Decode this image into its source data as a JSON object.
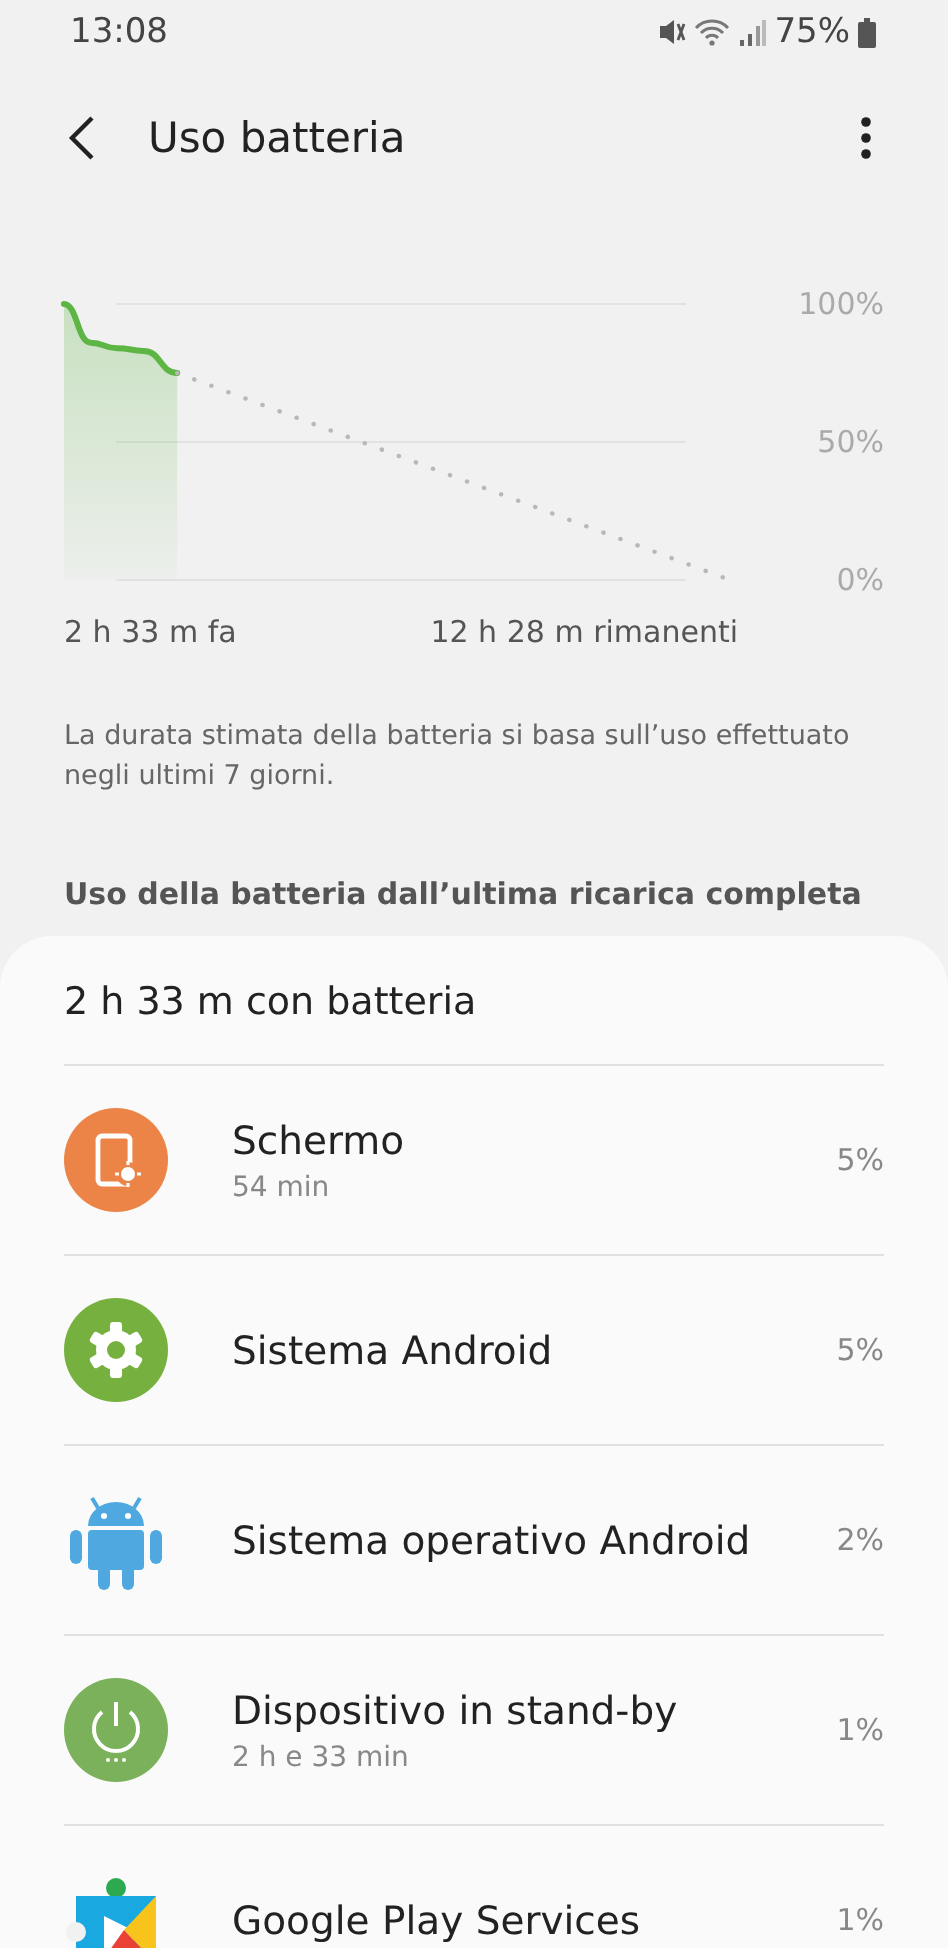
{
  "status_bar": {
    "time": "13:08",
    "battery": "75%"
  },
  "header": {
    "title": "Uso batteria"
  },
  "chart": {
    "time_labels": [
      "2 h 33 m fa",
      "12 h 28 m rimanenti"
    ],
    "level_labels": [
      "100%",
      "50%",
      "0%"
    ]
  },
  "note": "La durata stimata della batteria si basa sull’uso effettuato negli ultimi 7 giorni.",
  "section_title": "Uso della batteria dall’ultima ricarica completa",
  "summary": "2 h 33 m con batteria",
  "items": [
    {
      "kind": "screen",
      "name": "Schermo",
      "detail": "54 min",
      "percent": "5%"
    },
    {
      "kind": "gear",
      "name": "Sistema Android",
      "percent": "5%"
    },
    {
      "kind": "android",
      "name": "Sistema operativo Android",
      "percent": "2%"
    },
    {
      "kind": "power",
      "name": "Dispositivo in stand-by",
      "detail": "2 h e 33 min",
      "percent": "1%"
    },
    {
      "kind": "play",
      "name": "Google Play Services",
      "percent": "1%"
    }
  ]
}
